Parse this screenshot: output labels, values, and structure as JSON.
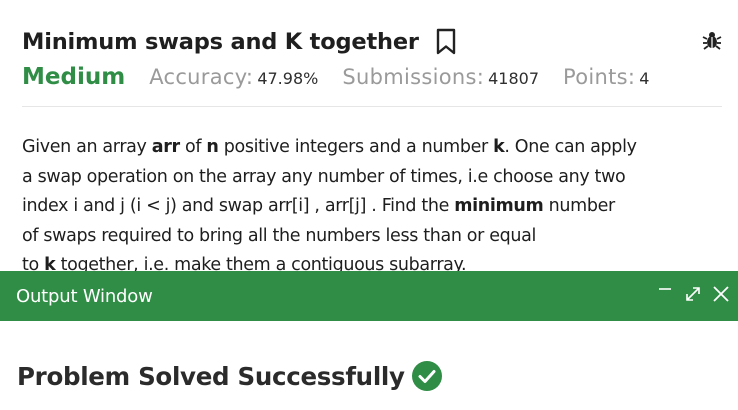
{
  "problem": {
    "title": "Minimum swaps and K together",
    "difficulty": "Medium",
    "accuracy_label": "Accuracy:",
    "accuracy_value": "47.98%",
    "submissions_label": "Submissions:",
    "submissions_value": "41807",
    "points_label": "Points:",
    "points_value": "4"
  },
  "description": {
    "l1_a": "Given an array ",
    "l1_b": "arr",
    "l1_c": " of ",
    "l1_d": "n",
    "l1_e": " positive integers and a number ",
    "l1_f": "k",
    "l1_g": ". One can apply",
    "l2": "a swap operation on the array any number of times, i.e choose any two",
    "l3_a": "index i and j (i < j) and swap arr[i] , arr[j] . Find the ",
    "l3_b": "minimum",
    "l3_c": " number",
    "l4": "of swaps required to bring all the numbers less than or equal",
    "l5_a": "to ",
    "l5_b": "k",
    "l5_c": " together, i.e. make them a contiguous subarray."
  },
  "output_window": {
    "title": "Output Window",
    "result_text": "Problem Solved Successfully"
  },
  "colors": {
    "accent_green": "#2f8d46",
    "muted_gray": "#9a9a9a"
  },
  "icons": {
    "bookmark": "bookmark-icon",
    "bug": "bug-icon",
    "minimize": "minimize-icon",
    "expand": "expand-icon",
    "close": "close-icon",
    "check": "check-circle-icon"
  }
}
